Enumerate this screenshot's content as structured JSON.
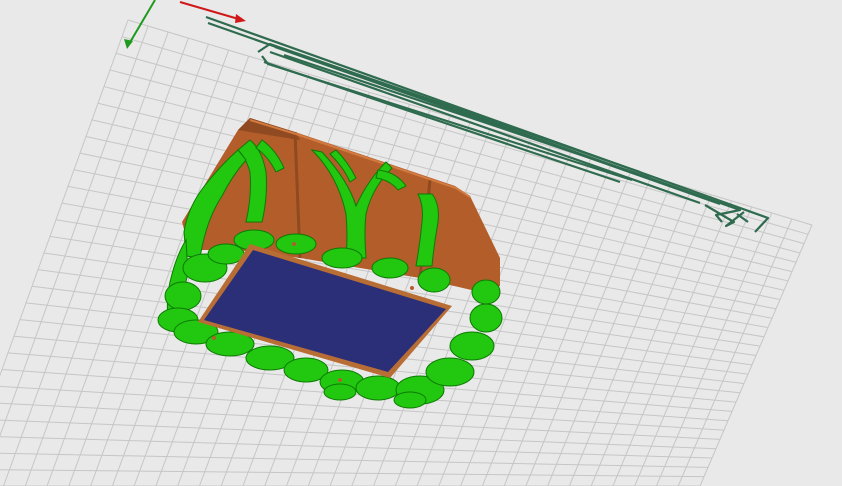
{
  "viewport": {
    "name": "3d-slicer-preview",
    "background": "#e9e9e9"
  },
  "colors": {
    "grid_line": "#c6c6c6",
    "x_axis": "#d01818",
    "y_axis": "#1f9a1f",
    "skirt": "#2f6b4f",
    "support": "#22c70f",
    "support_dark": "#0d7a05",
    "model_wall": "#b35d2a",
    "model_wall_dark": "#8f4a21",
    "top_surface": "#2b2f78",
    "top_surface_edge": "#b86d35"
  },
  "icons": {
    "x_axis": "axis-x-arrow-icon",
    "y_axis": "axis-y-arrow-icon"
  }
}
